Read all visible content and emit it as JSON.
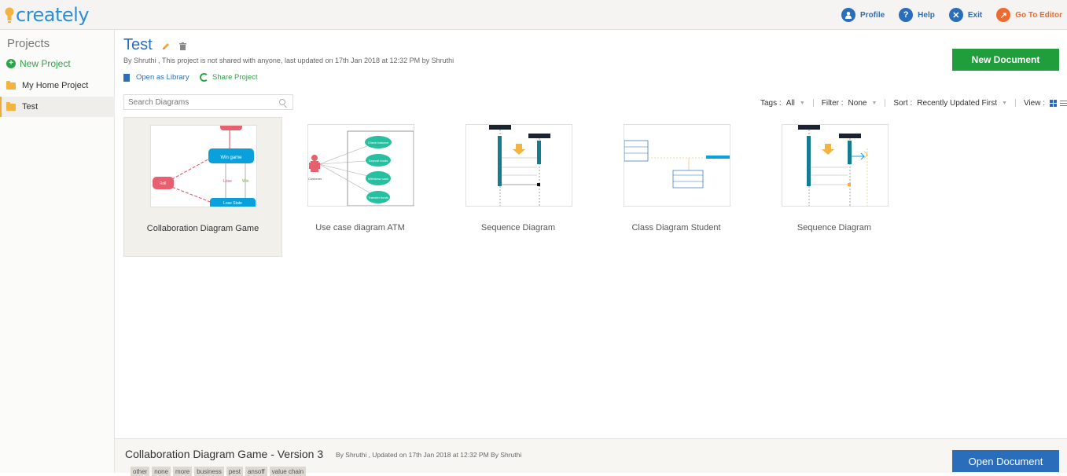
{
  "app": {
    "logo_text": "creately"
  },
  "topbar": {
    "actions": [
      {
        "label": "Profile",
        "icon": "user-icon",
        "glyph": "●"
      },
      {
        "label": "Help",
        "icon": "help-icon",
        "glyph": "?"
      },
      {
        "label": "Exit",
        "icon": "exit-icon",
        "glyph": "✕"
      },
      {
        "label": "Go To Editor",
        "icon": "editor-icon",
        "glyph": "↗"
      }
    ]
  },
  "sidebar": {
    "title": "Projects",
    "new_project_label": "New Project",
    "items": [
      {
        "label": "My Home Project",
        "icon": "folder-icon",
        "active": false
      },
      {
        "label": "Test",
        "icon": "folder-icon",
        "active": true
      }
    ]
  },
  "project": {
    "title": "Test",
    "meta": "By Shruthi , This project is not shared with anyone, last updated on 17th Jan 2018 at 12:32 PM by Shruthi",
    "open_as_library_label": "Open as Library",
    "share_project_label": "Share Project",
    "new_document_label": "New Document"
  },
  "filters": {
    "search_placeholder": "Search Diagrams",
    "tags_label": "Tags :",
    "tags_value": "All",
    "filter_label": "Filter :",
    "filter_value": "None",
    "sort_label": "Sort :",
    "sort_value": "Recently Updated First",
    "view_label": "View :"
  },
  "documents": [
    {
      "name": "Collaboration Diagram Game",
      "selected": true,
      "thumb": "collab"
    },
    {
      "name": "Use case diagram ATM",
      "selected": false,
      "thumb": "usecase"
    },
    {
      "name": "Sequence Diagram",
      "selected": false,
      "thumb": "sequence"
    },
    {
      "name": "Class Diagram Student",
      "selected": false,
      "thumb": "class"
    },
    {
      "name": "Sequence Diagram",
      "selected": false,
      "thumb": "sequence2"
    }
  ],
  "thumb_text": {
    "collab": {
      "node1": "Win game",
      "node2": "Roll",
      "node3": "Lose State",
      "edge1": "Lose",
      "edge2": "Win"
    },
    "usecase": {
      "actor": "Customer",
      "uc1": "Check balance",
      "uc2": "Deposit funds",
      "uc3": "Withdraw cash",
      "uc4": "Transfer funds"
    }
  },
  "selected_document": {
    "title": "Collaboration Diagram Game - Version 3",
    "meta": "By Shruthi , Updated on 17th Jan 2018 at 12:32 PM By Shruthi",
    "tags": [
      "other",
      "none",
      "more",
      "business",
      "pest",
      "ansoff",
      "value chain"
    ],
    "open_label": "Open Document"
  },
  "colors": {
    "accent_blue": "#2a6ebb",
    "accent_green": "#1f9e3b",
    "accent_orange": "#ef6a2f",
    "folder": "#f4b23f"
  }
}
